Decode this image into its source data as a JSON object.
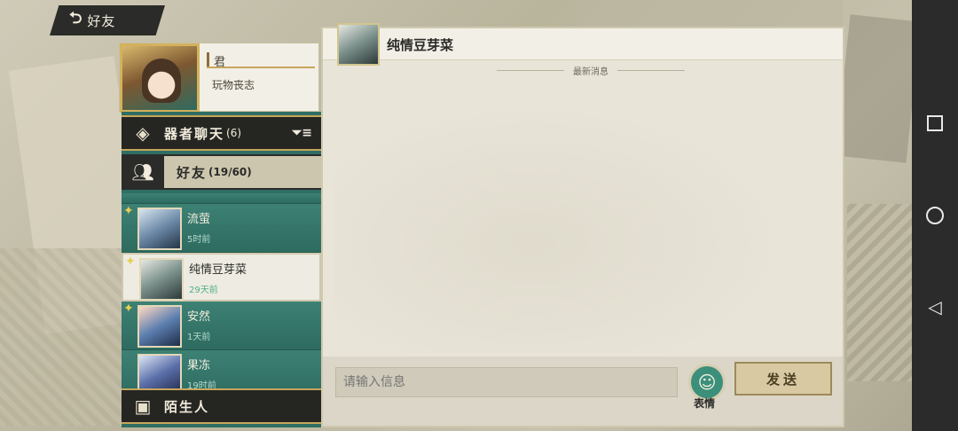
{
  "header": {
    "back_label": "好友"
  },
  "profile": {
    "name": "君",
    "signature": "玩物丧志"
  },
  "categories": {
    "group_chat": {
      "label": "器者聊天",
      "count": "(6)"
    },
    "friends": {
      "label": "好友",
      "count": "(19/60)"
    },
    "strangers": {
      "label": "陌生人"
    }
  },
  "friends": [
    {
      "name": "流萤",
      "time": "5时前"
    },
    {
      "name": "纯情豆芽菜",
      "time": "29天前"
    },
    {
      "name": "安然",
      "time": "1天前"
    },
    {
      "name": "果冻",
      "time": "19时前"
    }
  ],
  "chat": {
    "title": "纯情豆芽菜",
    "divider": "最新消息",
    "input_placeholder": "请输入信息",
    "emoji_label": "表情",
    "send_label": "发送"
  },
  "colors": {
    "panel_green": "#2f6e63",
    "dark": "#2b2b29",
    "gold": "#c8a65c",
    "paper": "#e8e4d8"
  },
  "icons": {
    "back": "back-arrow-icon",
    "group": "diamond-chat-icon",
    "filter": "filter-icon",
    "friends": "people-icon",
    "stranger": "contact-card-icon",
    "emoji": "smiley-icon"
  }
}
